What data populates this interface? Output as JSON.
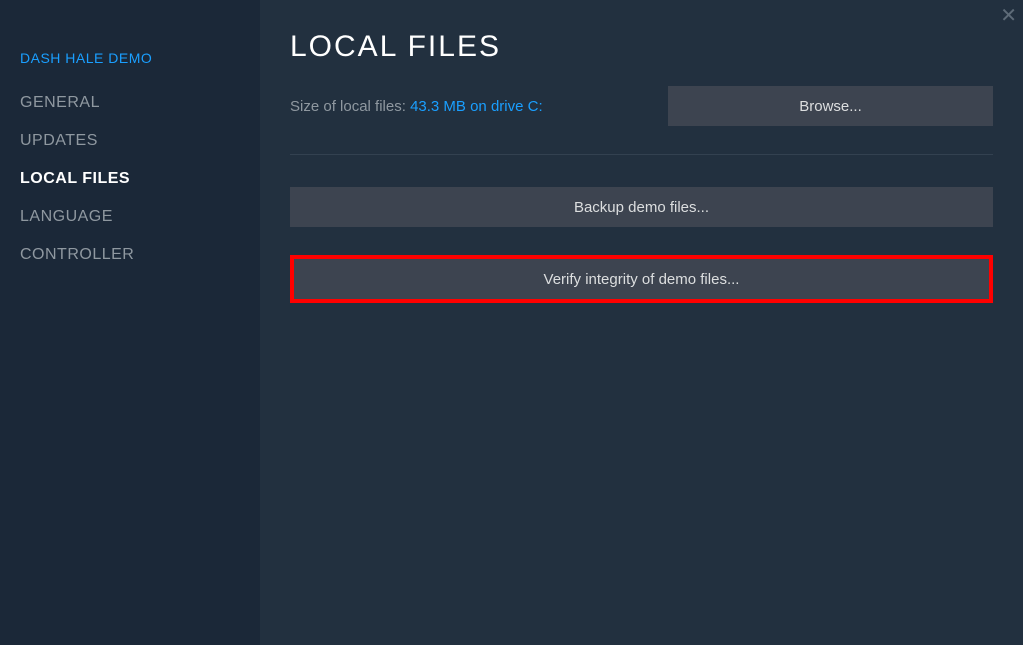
{
  "sidebar": {
    "title": "DASH HALE DEMO",
    "items": [
      {
        "label": "GENERAL",
        "active": false
      },
      {
        "label": "UPDATES",
        "active": false
      },
      {
        "label": "LOCAL FILES",
        "active": true
      },
      {
        "label": "LANGUAGE",
        "active": false
      },
      {
        "label": "CONTROLLER",
        "active": false
      }
    ]
  },
  "main": {
    "title": "LOCAL FILES",
    "size_label": "Size of local files: ",
    "size_value": "43.3 MB on drive C:",
    "browse_label": "Browse...",
    "backup_label": "Backup demo files...",
    "verify_label": "Verify integrity of demo files...",
    "close_glyph": "✕"
  }
}
